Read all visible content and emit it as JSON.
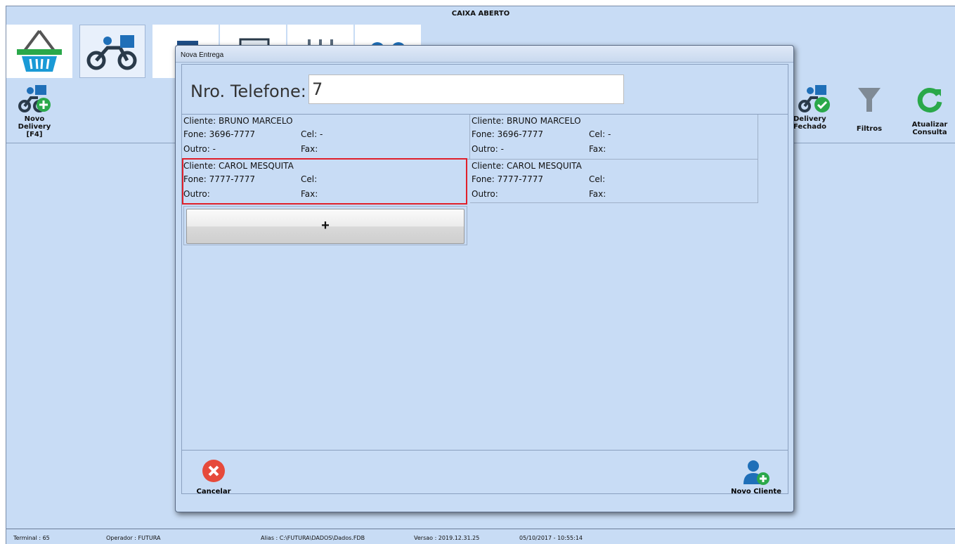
{
  "window": {
    "title": "CAIXA ABERTO"
  },
  "top_tabs": [
    {
      "name": "basket-icon"
    },
    {
      "name": "delivery-moto-icon"
    },
    {
      "name": "register-icon"
    },
    {
      "name": "cash-register-icon"
    },
    {
      "name": "mixer-icon"
    },
    {
      "name": "people-icon"
    }
  ],
  "side_actions": {
    "new_delivery": {
      "line1": "Novo Delivery",
      "line2": "[F4]"
    },
    "delivery_closed": {
      "line1": "Delivery",
      "line2": "Fechado"
    },
    "filters": {
      "line1": "Filtros"
    },
    "refresh": {
      "line1": "Atualizar",
      "line2": "Consulta"
    }
  },
  "status_bar": {
    "terminal": "Terminal : 65",
    "operator": "Operador : FUTURA",
    "alias": "Alias : C:\\FUTURA\\DADOS\\Dados.FDB",
    "version": "Versao : 2019.12.31.25",
    "datetime": "05/10/2017 - 10:55:14"
  },
  "dialog": {
    "title": "Nova Entrega",
    "phone_label": "Nro. Telefone:",
    "phone_value": "7",
    "clients": [
      {
        "cliente": "Cliente: BRUNO MARCELO",
        "fone": "Fone:  3696-7777",
        "cel": "Cel:  -",
        "outro": "Outro:  -",
        "fax": "Fax:"
      },
      {
        "cliente": "Cliente: BRUNO MARCELO",
        "fone": "Fone:  3696-7777",
        "cel": "Cel:  -",
        "outro": "Outro:  -",
        "fax": "Fax:"
      },
      {
        "cliente": "Cliente: CAROL MESQUITA",
        "fone": "Fone:  7777-7777",
        "cel": "Cel:",
        "outro": "Outro:",
        "fax": "Fax:"
      },
      {
        "cliente": "Cliente: CAROL MESQUITA",
        "fone": "Fone:  7777-7777",
        "cel": "Cel:",
        "outro": "Outro:",
        "fax": "Fax:"
      }
    ],
    "add_button": "+",
    "cancel_label": "Cancelar",
    "new_client_label": "Novo Cliente"
  },
  "colors": {
    "background": "#c8dcf5",
    "selection_border": "#e0202a",
    "brand_blue": "#1f6fb8",
    "cancel_red": "#e64a3b",
    "success_green": "#2aa84a"
  }
}
